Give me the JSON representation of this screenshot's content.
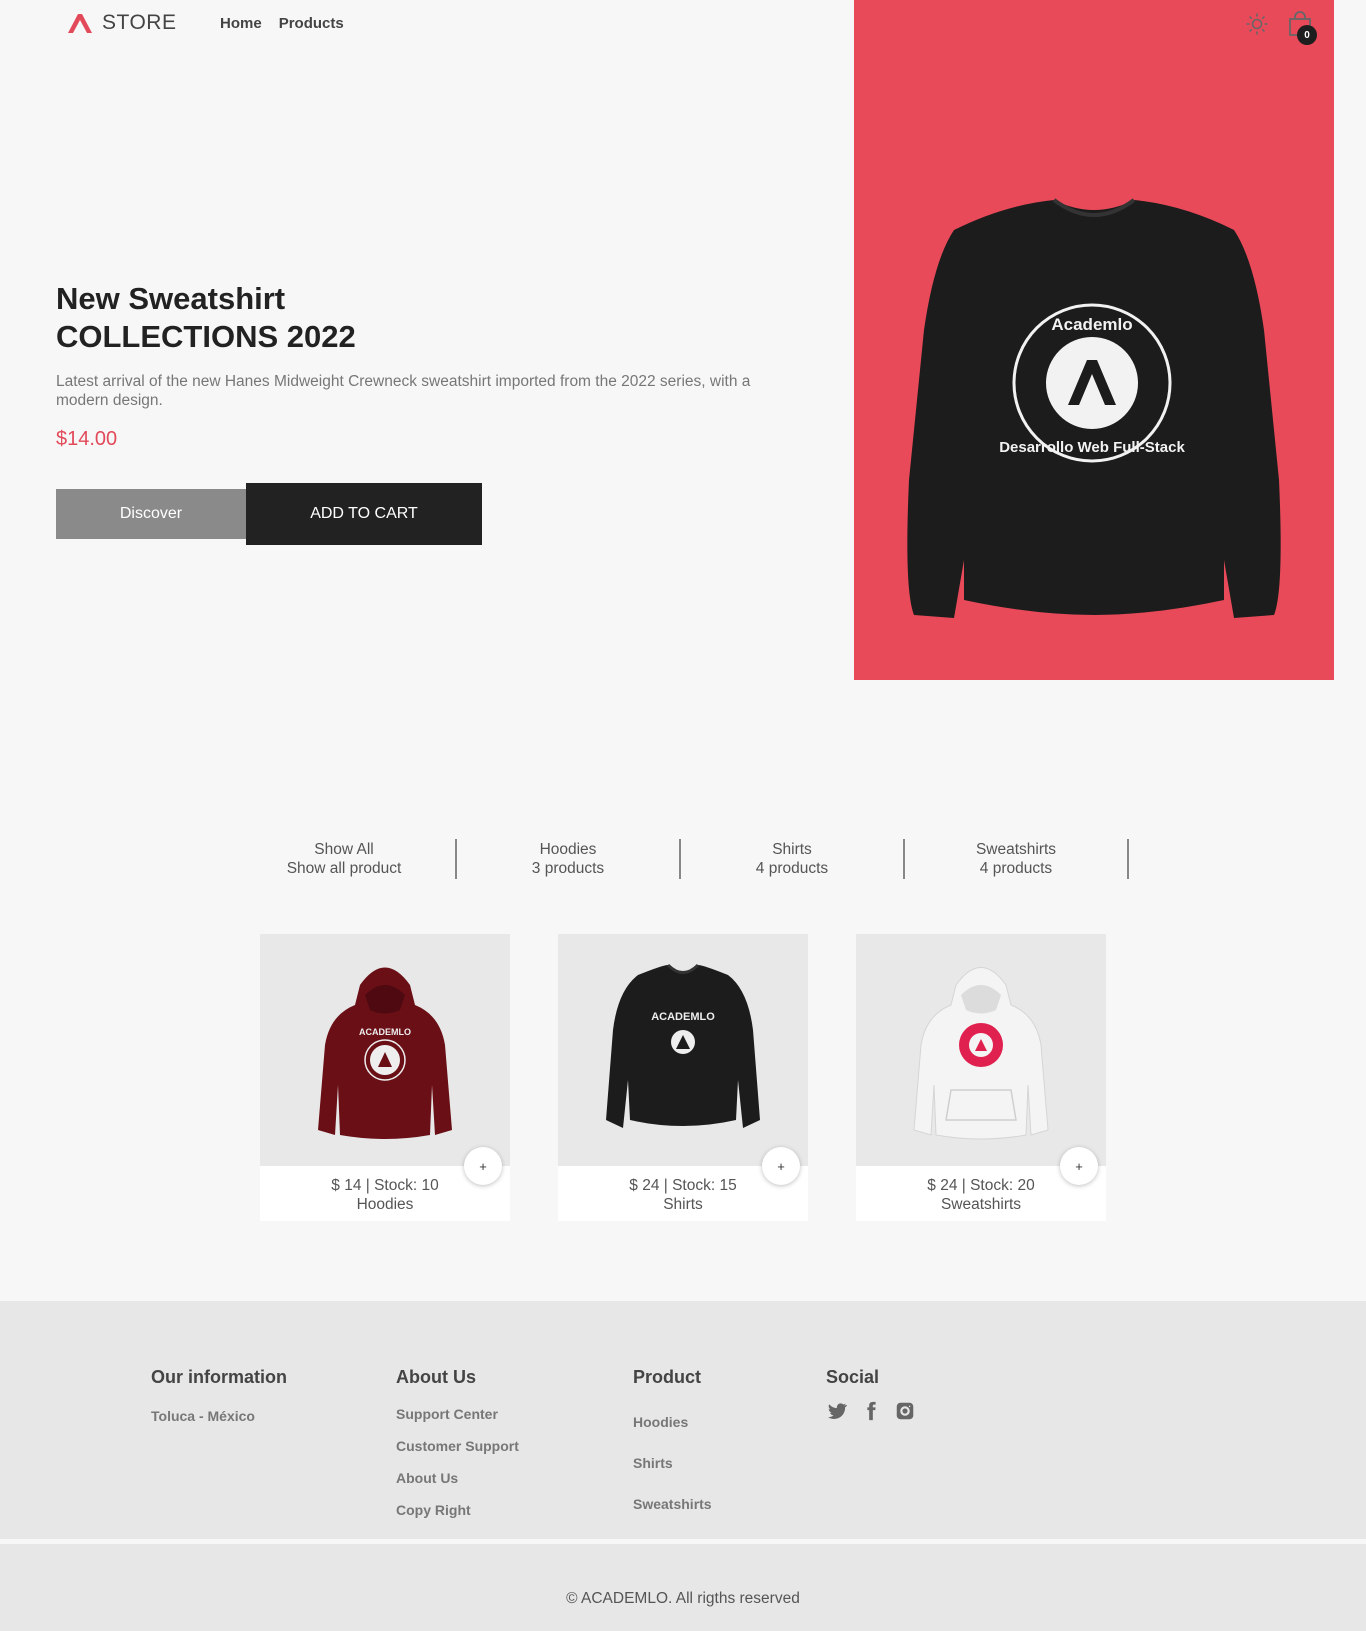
{
  "header": {
    "brand": "STORE",
    "nav": [
      "Home",
      "Products"
    ],
    "cart_count": "0"
  },
  "hero": {
    "title_line1": "New Sweatshirt",
    "title_line2": "COLLECTIONS 2022",
    "description": "Latest arrival of the new Hanes Midweight Crewneck sweatshirt imported from the 2022 series, with a modern design.",
    "price": "$14.00",
    "discover_label": "Discover",
    "add_to_cart_label": "ADD TO CART",
    "image_bg": "#e94a59"
  },
  "filters": [
    {
      "title": "Show All",
      "subtitle": "Show all product"
    },
    {
      "title": "Hoodies",
      "subtitle": "3 products"
    },
    {
      "title": "Shirts",
      "subtitle": "4 products"
    },
    {
      "title": "Sweatshirts",
      "subtitle": "4 products"
    }
  ],
  "products": [
    {
      "price_stock": "$ 14 | Stock: 10",
      "category": "Hoodies",
      "add_label": "+",
      "color": "#6a0f16"
    },
    {
      "price_stock": "$ 24 | Stock: 15",
      "category": "Shirts",
      "add_label": "+",
      "color": "#1c1c1c"
    },
    {
      "price_stock": "$ 24 | Stock: 20",
      "category": "Sweatshirts",
      "add_label": "+",
      "color": "#e6e6e6"
    }
  ],
  "footer": {
    "info_title": "Our information",
    "info_location": "Toluca - México",
    "about_title": "About Us",
    "about_links": [
      "Support Center",
      "Customer Support",
      "About Us",
      "Copy Right"
    ],
    "product_title": "Product",
    "product_links": [
      "Hoodies",
      "Shirts",
      "Sweatshirts"
    ],
    "social_title": "Social",
    "social_icons": [
      "twitter-icon",
      "facebook-icon",
      "instagram-icon"
    ],
    "copyright": "© ACADEMLO. All rigths reserved"
  },
  "colors": {
    "accent": "#e24a5a",
    "dark": "#222222",
    "footer_bg": "#e7e7e7"
  }
}
